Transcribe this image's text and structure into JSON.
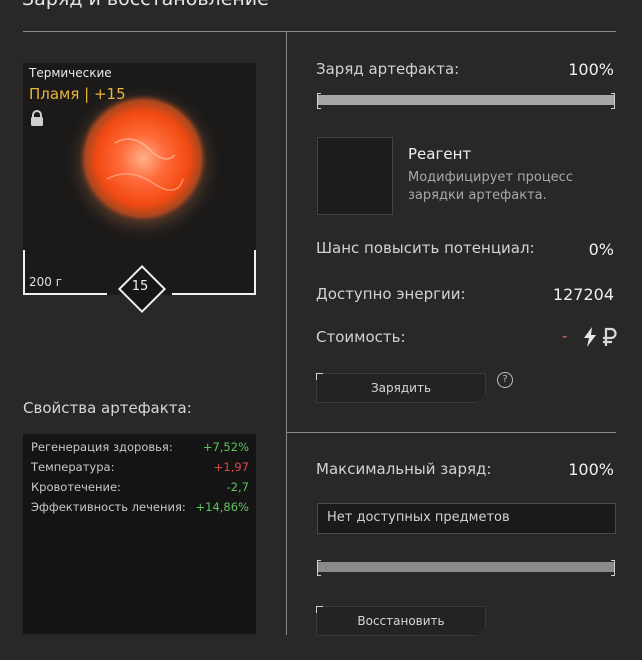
{
  "header": {
    "title": "Заряд и восстановление"
  },
  "artifact": {
    "category": "Термические",
    "name": "Пламя | +15",
    "weight": "200 г",
    "level": "15",
    "lock_icon": "lock-icon"
  },
  "properties": {
    "title": "Свойства артефакта:",
    "rows": [
      {
        "label": "Регенерация здоровья:",
        "value": "+7,52%",
        "tone": "positive"
      },
      {
        "label": "Температура:",
        "value": "+1,97",
        "tone": "negative"
      },
      {
        "label": "Кровотечение:",
        "value": "-2,7",
        "tone": "positive"
      },
      {
        "label": "Эффективность лечения:",
        "value": "+14,86%",
        "tone": "positive"
      }
    ]
  },
  "charge": {
    "label": "Заряд артефакта:",
    "value": "100%",
    "fill_fraction": 1.0
  },
  "reagent": {
    "title": "Реагент",
    "description": "Модифицирует процесс зарядки артефакта."
  },
  "stats": {
    "potential_label": "Шанс повысить потенциал:",
    "potential_value": "0%",
    "energy_label": "Доступно энергии:",
    "energy_value": "127204",
    "cost_label": "Стоимость:",
    "cost_value": "-",
    "cost_icons": [
      "lightning-icon",
      "ruble-icon"
    ]
  },
  "charge_button": {
    "label": "Зарядить",
    "help": "?"
  },
  "max_charge": {
    "label": "Максимальный заряд:",
    "value": "100%",
    "fill_fraction": 1.0
  },
  "restore": {
    "field_text": "Нет доступных предметов",
    "button_label": "Восстановить"
  },
  "colors": {
    "background": "#2a2826",
    "accent_gold": "#e8b43a",
    "positive": "#5fc45f",
    "negative": "#d84a4a"
  }
}
